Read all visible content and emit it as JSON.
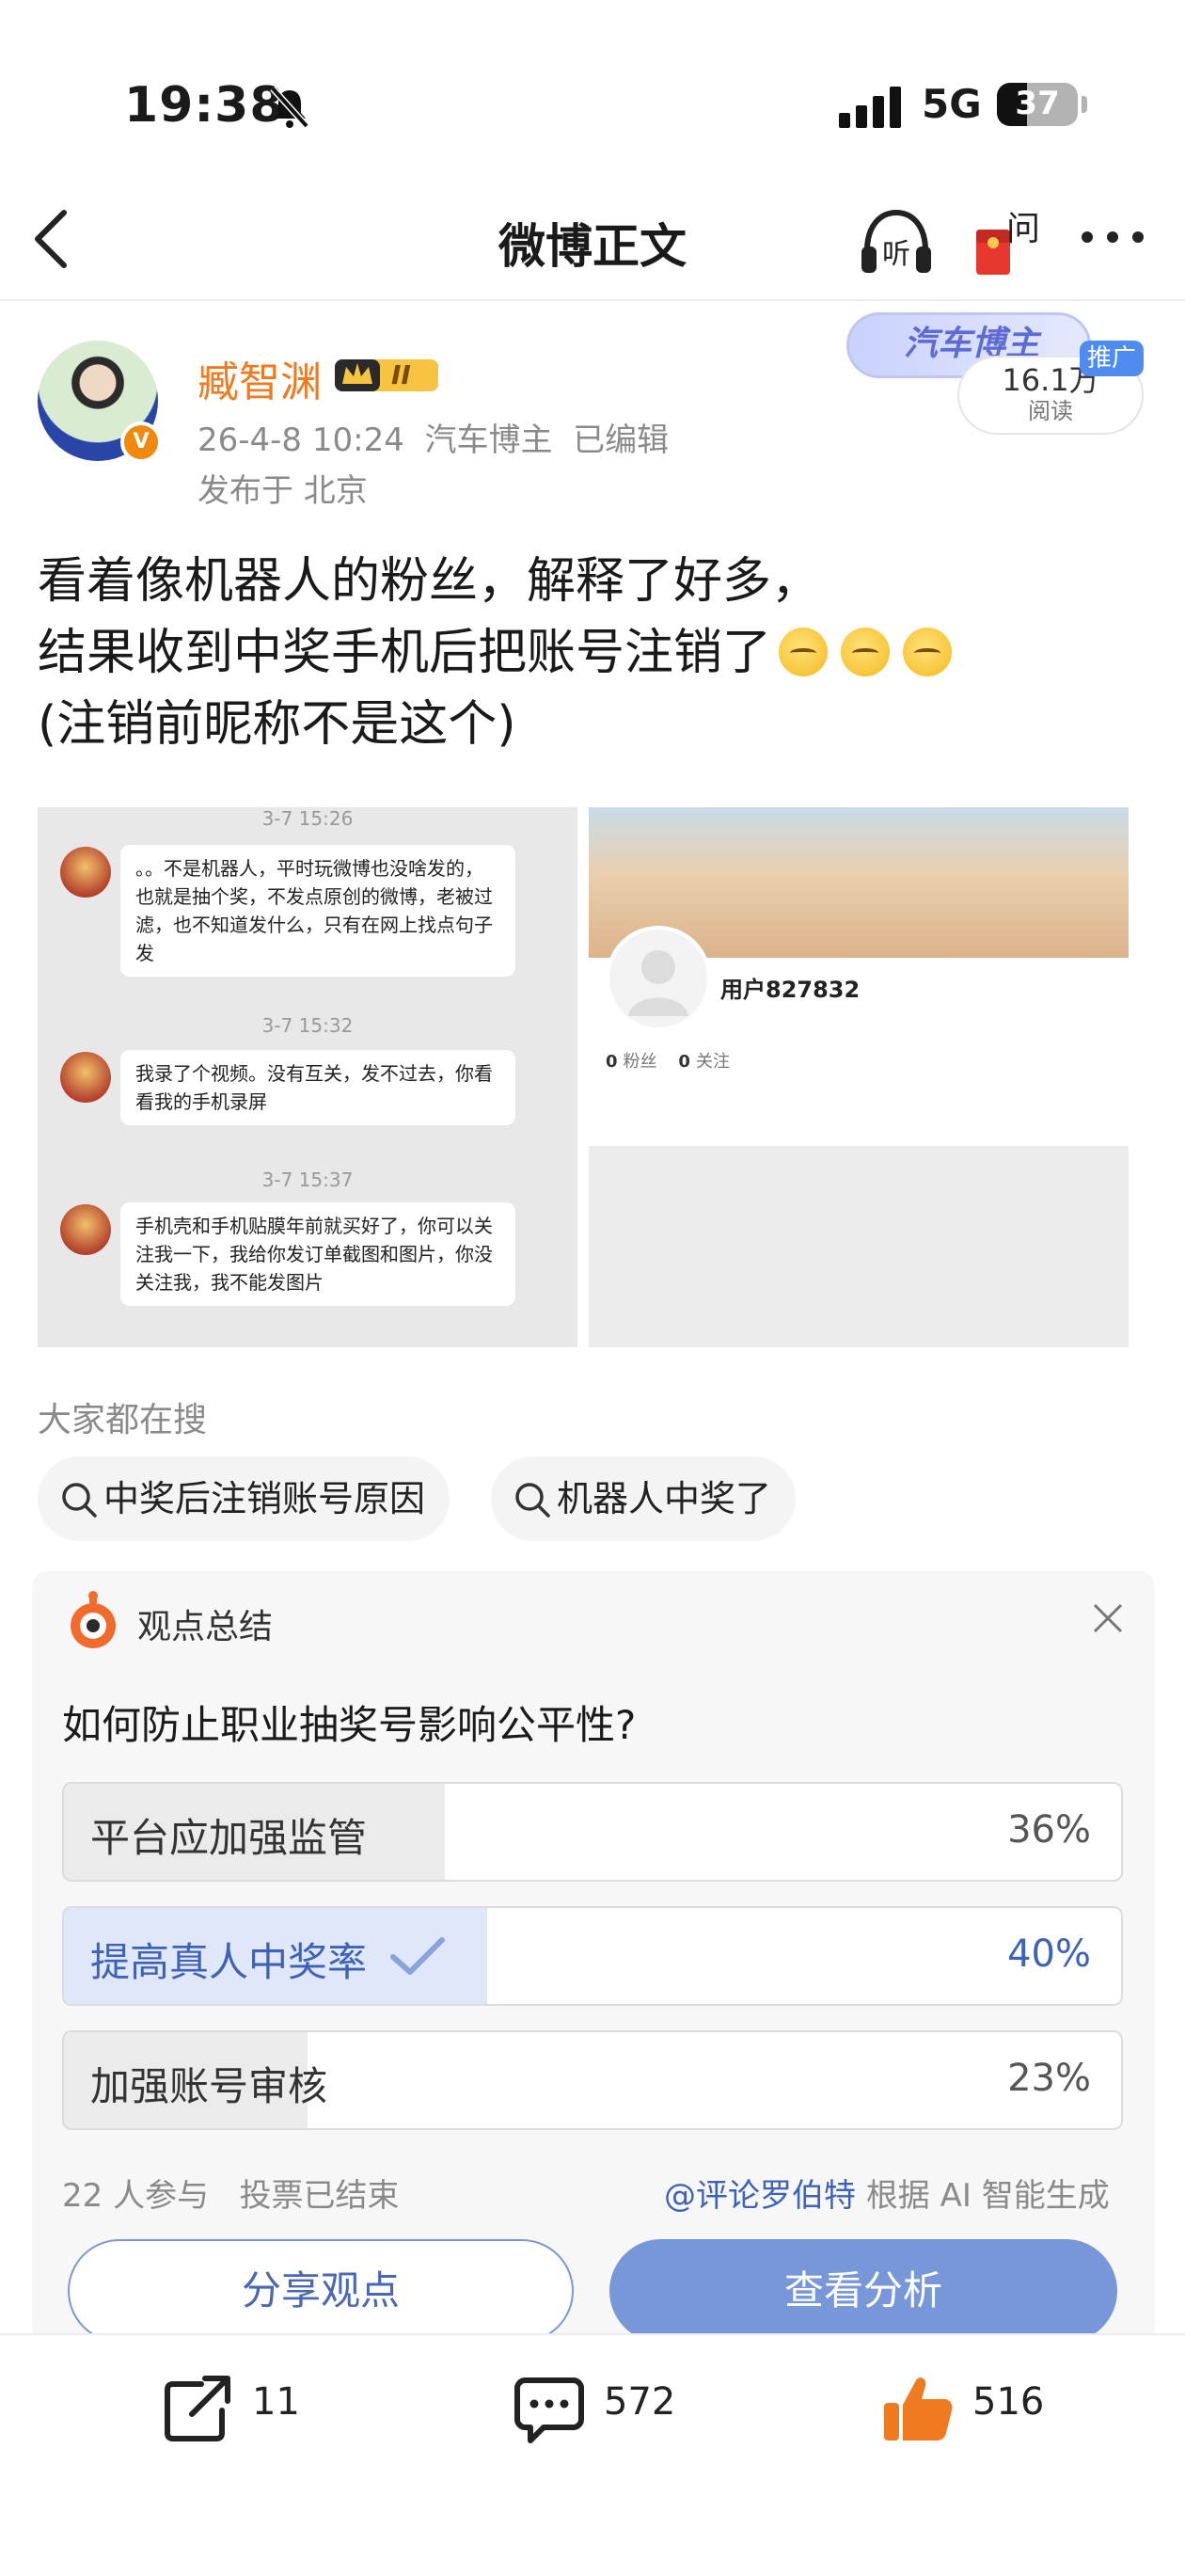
{
  "status_bar": {
    "time": "19:38",
    "network": "5G",
    "battery": "37",
    "battery_level": 0.37
  },
  "nav": {
    "title": "微博正文",
    "listen_icon": "headphones-icon",
    "ask_label": "问",
    "more_icon": "more-icon"
  },
  "post": {
    "author": "臧智渊",
    "level_badge": "II",
    "datetime": "26-4-8 10:24",
    "role": "汽车博主",
    "edited": "已编辑",
    "location": "发布于 北京",
    "topic_tag": "汽车博主",
    "promo_label": "推广",
    "reads_count": "16.1万",
    "reads_label": "阅读",
    "text_line1": "看着像机器人的粉丝，解释了好多，",
    "text_line2": "结果收到中奖手机后把账号注销了",
    "text_line3": "(注销前昵称不是这个)",
    "emoji_count": 3
  },
  "images": {
    "chat": [
      {
        "time": "3-7 15:26",
        "text": "。。不是机器人，平时玩微博也没啥发的，也就是抽个奖，不发点原创的微博，老被过滤，也不知道发什么，只有在网上找点句子发"
      },
      {
        "time": "3-7 15:32",
        "text": "我录了个视频。没有互关，发不过去，你看看我的手机录屏"
      },
      {
        "time": "3-7 15:37",
        "text": "手机壳和手机贴膜年前就买好了，你可以关注我一下，我给你发订单截图和图片，你没关注我，我不能发图片"
      }
    ],
    "profile": {
      "username": "用户827832",
      "fans": "0",
      "fans_label": "粉丝",
      "follow": "0",
      "follow_label": "关注"
    }
  },
  "search": {
    "label": "大家都在搜",
    "pills": [
      "中奖后注销账号原因",
      "机器人中奖了"
    ]
  },
  "poll": {
    "header": "观点总结",
    "question": "如何防止职业抽奖号影响公平性?",
    "options": [
      {
        "label": "平台应加强监管",
        "percent": "36%",
        "value": 36,
        "selected": false
      },
      {
        "label": "提高真人中奖率",
        "percent": "40%",
        "value": 40,
        "selected": true
      },
      {
        "label": "加强账号审核",
        "percent": "23%",
        "value": 23,
        "selected": false
      }
    ],
    "participants": "22 人参与",
    "status": "投票已结束",
    "source_at": "@评论罗伯特",
    "source_text": "根据 AI 智能生成",
    "share_button": "分享观点",
    "analyze_button": "查看分析"
  },
  "actions": {
    "reposts": "11",
    "comments": "572",
    "likes": "516"
  },
  "colors": {
    "accent_orange": "#f07a1f",
    "poll_blue": "#3e63b6",
    "analyze_bg": "#7797d9",
    "like_orange": "#f07a1f"
  }
}
